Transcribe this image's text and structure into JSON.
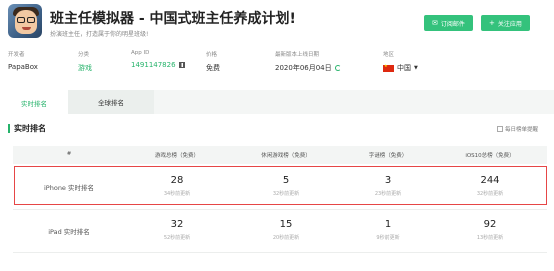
{
  "app": {
    "title": "班主任模拟器 - 中国式班主任养成计划!",
    "subtitle": "扮演班主任，打造属于你的明星班级!"
  },
  "actions": {
    "subscribe_label": "订阅邮件",
    "follow_label": "关注应用"
  },
  "info": {
    "developer": {
      "label": "开发者",
      "value": "PapaBox"
    },
    "category": {
      "label": "分类",
      "value": "游戏"
    },
    "app_id": {
      "label": "App ID",
      "value": "1491147826"
    },
    "price": {
      "label": "价格",
      "value": "免费"
    },
    "latest_release": {
      "label": "最新版本上线日期",
      "value": "2020年06月04日"
    },
    "region": {
      "label": "地区",
      "value": "中国"
    }
  },
  "tabs": [
    {
      "label": "实时排名",
      "active": true
    },
    {
      "label": "全球排名",
      "active": false
    }
  ],
  "section": {
    "title": "实时排名",
    "daily_check_label": "每日榜单提醒"
  },
  "table": {
    "headers": [
      "#",
      "游戏总榜（免费）",
      "休闲游戏榜（免费）",
      "字谜榜（免费）",
      "iOS10总榜（免费）"
    ],
    "rows": [
      {
        "label": "iPhone 实时排名",
        "highlighted": true,
        "cells": [
          {
            "rank": "28",
            "updated": "34秒前更新"
          },
          {
            "rank": "5",
            "updated": "32秒前更新"
          },
          {
            "rank": "3",
            "updated": "23秒前更新"
          },
          {
            "rank": "244",
            "updated": "32秒前更新"
          }
        ]
      },
      {
        "label": "iPad 实时排名",
        "highlighted": false,
        "cells": [
          {
            "rank": "32",
            "updated": "52秒前更新"
          },
          {
            "rank": "15",
            "updated": "20秒前更新"
          },
          {
            "rank": "1",
            "updated": "9秒前更新"
          },
          {
            "rank": "92",
            "updated": "13秒前更新"
          }
        ]
      }
    ]
  },
  "colors": {
    "accent": "#34c27c",
    "highlight_border": "#e64646"
  }
}
